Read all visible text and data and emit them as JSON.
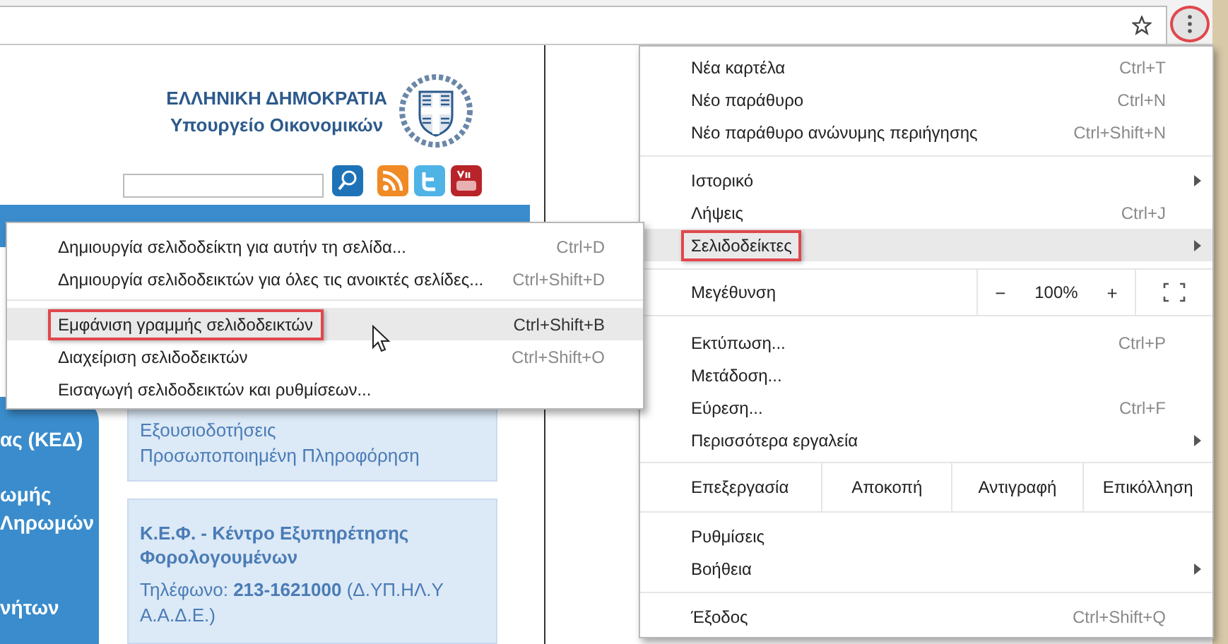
{
  "toolbar": {
    "menu_button": {
      "marked": true
    }
  },
  "webpage": {
    "header": {
      "line_1": "ΕΛΛΗΝΙΚΗ ΔΗΜΟΚΡΑΤΙΑ",
      "line_2": "Υπουργείο Οικονομικών"
    },
    "sidebar": {
      "items": [
        "ας (ΚΕΔ)",
        "ωμής\nΛηρωμών",
        "νήτων"
      ]
    },
    "cards": [
      {
        "kind": "links",
        "lines": [
          "Εξουσιοδοτήσεις",
          "Προσωποποιημένη Πληροφόρηση"
        ]
      },
      {
        "kind": "contact",
        "title": "Κ.Ε.Φ. - Κέντρο Εξυπηρέτησης Φορολογουμένων",
        "text": "Τηλέφωνο: **213-1621000**  (Δ.ΥΠ.ΗΛ.Υ Α.Α.Δ.Ε.)"
      }
    ]
  },
  "bookmarks_submenu": {
    "sections": [
      [
        {
          "label": "Δημιουργία σελιδοδείκτη για αυτήν τη σελίδα...",
          "shortcut": "Ctrl+D",
          "selected": false,
          "marked": false
        },
        {
          "label": "Δημιουργία σελιδοδεικτών για όλες τις ανοικτές σελίδες...",
          "shortcut": "Ctrl+Shift+D",
          "selected": false,
          "marked": false
        }
      ],
      [
        {
          "label": "Εμφάνιση γραμμής σελιδοδεικτών",
          "shortcut": "Ctrl+Shift+B",
          "selected": true,
          "marked": true
        },
        {
          "label": "Διαχείριση σελιδοδεικτών",
          "shortcut": "Ctrl+Shift+O",
          "selected": false,
          "marked": false
        },
        {
          "label": "Εισαγωγή σελιδοδεικτών και ρυθμίσεων...",
          "selected": false,
          "marked": false
        }
      ]
    ]
  },
  "main_menu": {
    "sections": [
      {
        "kind": "items",
        "items": [
          {
            "label": "Νέα καρτέλα",
            "shortcut": "Ctrl+T",
            "selected": false,
            "marked": false,
            "submenu": false
          },
          {
            "label": "Νέο παράθυρο",
            "shortcut": "Ctrl+N",
            "selected": false,
            "marked": false,
            "submenu": false
          },
          {
            "label": "Νέο παράθυρο ανώνυμης περιήγησης",
            "shortcut": "Ctrl+Shift+N",
            "selected": false,
            "marked": false,
            "submenu": false
          }
        ]
      },
      {
        "kind": "items",
        "items": [
          {
            "label": "Ιστορικό",
            "selected": false,
            "marked": false,
            "submenu": true
          },
          {
            "label": "Λήψεις",
            "shortcut": "Ctrl+J",
            "selected": false,
            "marked": false,
            "submenu": false
          },
          {
            "label": "Σελιδοδείκτες",
            "selected": true,
            "marked": true,
            "submenu": true
          }
        ]
      },
      {
        "kind": "zoom",
        "label": "Μεγέθυνση",
        "minus": "−",
        "value": "100%",
        "plus": "+"
      },
      {
        "kind": "items",
        "items": [
          {
            "label": "Εκτύπωση...",
            "shortcut": "Ctrl+P",
            "selected": false,
            "marked": false,
            "submenu": false
          },
          {
            "label": "Μετάδοση...",
            "selected": false,
            "marked": false,
            "submenu": false
          },
          {
            "label": "Εύρεση...",
            "shortcut": "Ctrl+F",
            "selected": false,
            "marked": false,
            "submenu": false
          },
          {
            "label": "Περισσότερα εργαλεία",
            "selected": false,
            "marked": false,
            "submenu": true
          }
        ]
      },
      {
        "kind": "edit",
        "label": "Επεξεργασία",
        "buttons": [
          "Αποκοπή",
          "Αντιγραφή",
          "Επικόλληση"
        ]
      },
      {
        "kind": "items",
        "items": [
          {
            "label": "Ρυθμίσεις",
            "selected": false,
            "marked": false,
            "submenu": false
          },
          {
            "label": "Βοήθεια",
            "selected": false,
            "marked": false,
            "submenu": true
          }
        ]
      },
      {
        "kind": "items",
        "items": [
          {
            "label": "Έξοδος",
            "shortcut": "Ctrl+Shift+Q",
            "selected": false,
            "marked": false,
            "submenu": false
          }
        ]
      }
    ]
  }
}
